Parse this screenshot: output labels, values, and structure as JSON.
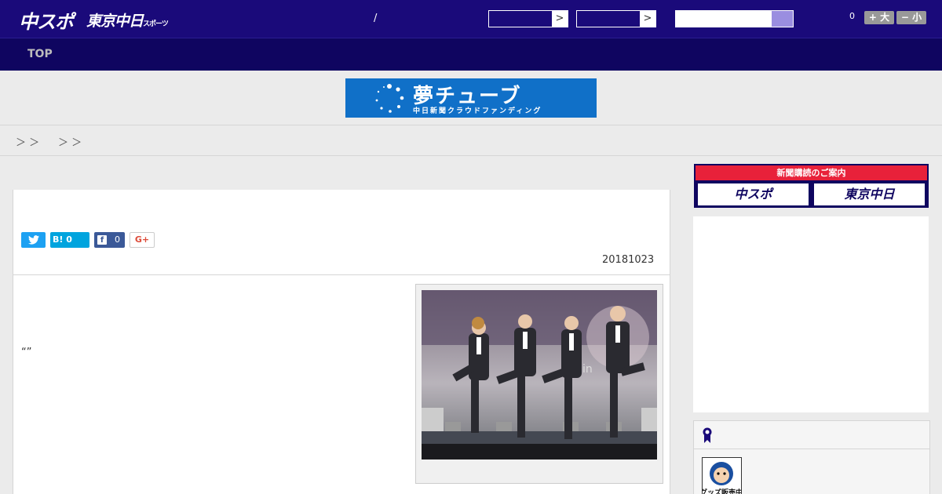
{
  "header": {
    "logo_chuspo": "中スポ",
    "logo_tokyo": "東京中日",
    "logo_tokyo_small": "スポーツ",
    "slash": "/",
    "select1_arrow": ">",
    "select2_arrow": ">",
    "font_count": "0",
    "font_plus": "+ 大",
    "font_minus": "− 小"
  },
  "nav": {
    "top_label": "TOP"
  },
  "banner": {
    "title": "夢チューブ",
    "subtitle": "中日新聞クラウドファンディング"
  },
  "breadcrumb": {
    "sep1": "＞ ＞",
    "sep2": "＞ ＞"
  },
  "article": {
    "share_hatena": "B! 0",
    "share_fb_icon": "f",
    "share_fb_count": "0",
    "share_gplus": "G+",
    "date": "20181023",
    "quote": "“”"
  },
  "sidebar": {
    "subscribe_head": "新聞購読のご案内",
    "subscribe_chuspo": "中スポ",
    "subscribe_tokyo": "東京中日",
    "goods_label": "グッズ販売中"
  },
  "colors": {
    "header_bg": "#1a0a7a",
    "nav_bg": "#0f0560",
    "accent_red": "#e8213a",
    "accent_purple": "#6a5fc0",
    "banner_blue": "#1070c8"
  }
}
